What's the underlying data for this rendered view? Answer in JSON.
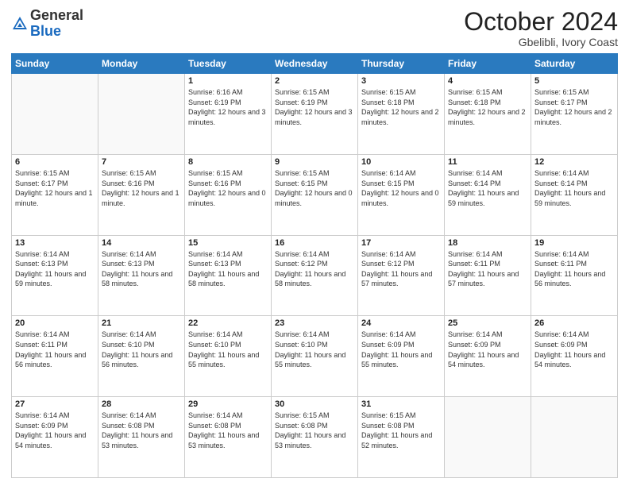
{
  "logo": {
    "general": "General",
    "blue": "Blue"
  },
  "header": {
    "month": "October 2024",
    "location": "Gbelibli, Ivory Coast"
  },
  "days_of_week": [
    "Sunday",
    "Monday",
    "Tuesday",
    "Wednesday",
    "Thursday",
    "Friday",
    "Saturday"
  ],
  "weeks": [
    [
      {
        "day": "",
        "info": ""
      },
      {
        "day": "",
        "info": ""
      },
      {
        "day": "1",
        "info": "Sunrise: 6:16 AM\nSunset: 6:19 PM\nDaylight: 12 hours and 3 minutes."
      },
      {
        "day": "2",
        "info": "Sunrise: 6:15 AM\nSunset: 6:19 PM\nDaylight: 12 hours and 3 minutes."
      },
      {
        "day": "3",
        "info": "Sunrise: 6:15 AM\nSunset: 6:18 PM\nDaylight: 12 hours and 2 minutes."
      },
      {
        "day": "4",
        "info": "Sunrise: 6:15 AM\nSunset: 6:18 PM\nDaylight: 12 hours and 2 minutes."
      },
      {
        "day": "5",
        "info": "Sunrise: 6:15 AM\nSunset: 6:17 PM\nDaylight: 12 hours and 2 minutes."
      }
    ],
    [
      {
        "day": "6",
        "info": "Sunrise: 6:15 AM\nSunset: 6:17 PM\nDaylight: 12 hours and 1 minute."
      },
      {
        "day": "7",
        "info": "Sunrise: 6:15 AM\nSunset: 6:16 PM\nDaylight: 12 hours and 1 minute."
      },
      {
        "day": "8",
        "info": "Sunrise: 6:15 AM\nSunset: 6:16 PM\nDaylight: 12 hours and 0 minutes."
      },
      {
        "day": "9",
        "info": "Sunrise: 6:15 AM\nSunset: 6:15 PM\nDaylight: 12 hours and 0 minutes."
      },
      {
        "day": "10",
        "info": "Sunrise: 6:14 AM\nSunset: 6:15 PM\nDaylight: 12 hours and 0 minutes."
      },
      {
        "day": "11",
        "info": "Sunrise: 6:14 AM\nSunset: 6:14 PM\nDaylight: 11 hours and 59 minutes."
      },
      {
        "day": "12",
        "info": "Sunrise: 6:14 AM\nSunset: 6:14 PM\nDaylight: 11 hours and 59 minutes."
      }
    ],
    [
      {
        "day": "13",
        "info": "Sunrise: 6:14 AM\nSunset: 6:13 PM\nDaylight: 11 hours and 59 minutes."
      },
      {
        "day": "14",
        "info": "Sunrise: 6:14 AM\nSunset: 6:13 PM\nDaylight: 11 hours and 58 minutes."
      },
      {
        "day": "15",
        "info": "Sunrise: 6:14 AM\nSunset: 6:13 PM\nDaylight: 11 hours and 58 minutes."
      },
      {
        "day": "16",
        "info": "Sunrise: 6:14 AM\nSunset: 6:12 PM\nDaylight: 11 hours and 58 minutes."
      },
      {
        "day": "17",
        "info": "Sunrise: 6:14 AM\nSunset: 6:12 PM\nDaylight: 11 hours and 57 minutes."
      },
      {
        "day": "18",
        "info": "Sunrise: 6:14 AM\nSunset: 6:11 PM\nDaylight: 11 hours and 57 minutes."
      },
      {
        "day": "19",
        "info": "Sunrise: 6:14 AM\nSunset: 6:11 PM\nDaylight: 11 hours and 56 minutes."
      }
    ],
    [
      {
        "day": "20",
        "info": "Sunrise: 6:14 AM\nSunset: 6:11 PM\nDaylight: 11 hours and 56 minutes."
      },
      {
        "day": "21",
        "info": "Sunrise: 6:14 AM\nSunset: 6:10 PM\nDaylight: 11 hours and 56 minutes."
      },
      {
        "day": "22",
        "info": "Sunrise: 6:14 AM\nSunset: 6:10 PM\nDaylight: 11 hours and 55 minutes."
      },
      {
        "day": "23",
        "info": "Sunrise: 6:14 AM\nSunset: 6:10 PM\nDaylight: 11 hours and 55 minutes."
      },
      {
        "day": "24",
        "info": "Sunrise: 6:14 AM\nSunset: 6:09 PM\nDaylight: 11 hours and 55 minutes."
      },
      {
        "day": "25",
        "info": "Sunrise: 6:14 AM\nSunset: 6:09 PM\nDaylight: 11 hours and 54 minutes."
      },
      {
        "day": "26",
        "info": "Sunrise: 6:14 AM\nSunset: 6:09 PM\nDaylight: 11 hours and 54 minutes."
      }
    ],
    [
      {
        "day": "27",
        "info": "Sunrise: 6:14 AM\nSunset: 6:09 PM\nDaylight: 11 hours and 54 minutes."
      },
      {
        "day": "28",
        "info": "Sunrise: 6:14 AM\nSunset: 6:08 PM\nDaylight: 11 hours and 53 minutes."
      },
      {
        "day": "29",
        "info": "Sunrise: 6:14 AM\nSunset: 6:08 PM\nDaylight: 11 hours and 53 minutes."
      },
      {
        "day": "30",
        "info": "Sunrise: 6:15 AM\nSunset: 6:08 PM\nDaylight: 11 hours and 53 minutes."
      },
      {
        "day": "31",
        "info": "Sunrise: 6:15 AM\nSunset: 6:08 PM\nDaylight: 11 hours and 52 minutes."
      },
      {
        "day": "",
        "info": ""
      },
      {
        "day": "",
        "info": ""
      }
    ]
  ]
}
